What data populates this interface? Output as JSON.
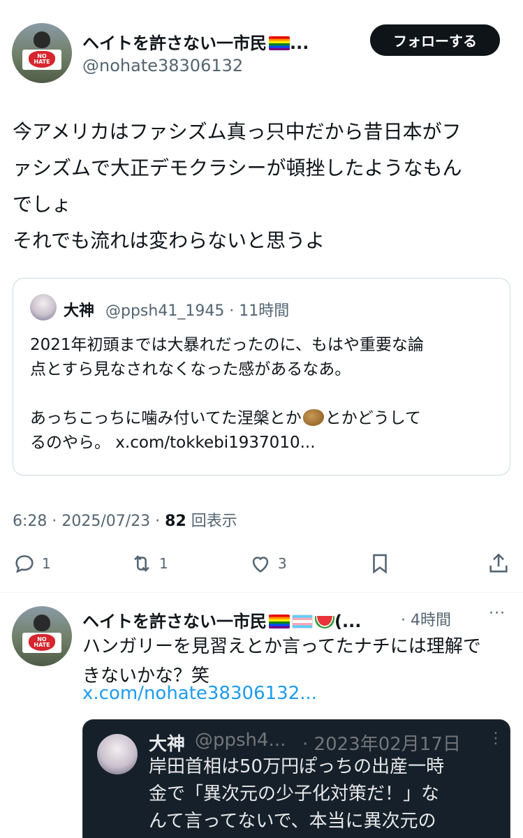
{
  "main_post": {
    "author_name": "ヘイトを許さない一市民",
    "author_name_suffix": "...",
    "handle": "@nohate38306132",
    "follow_label": "フォローする",
    "avatar_sign_text": "NO HATE",
    "body_lines": [
      "今アメリカはファシズム真っ只中だから昔日本がフ",
      "ァシズムで大正デモクラシーが頓挫したようなもん",
      "でしょ",
      "それでも流れは変わらないと思うよ"
    ],
    "quote": {
      "author_name": "大神",
      "handle_time": "@ppsh41_1945 · 11時間",
      "line1": "2021年初頭までは大暴れだったのに、もはや重要な論",
      "line2": "点とすら見なされなくなった感があるなあ。",
      "line3": "",
      "line4_before": "あっちこっちに噛み付いてた涅槃とか",
      "line4_after": "とかどうして",
      "line5": "るのやら。 x.com/tokkebi1937010..."
    },
    "meta": {
      "time_date": "6:28 · 2025/07/23 · ",
      "views_count": "82",
      "views_label": " 回表示"
    },
    "actions": {
      "replies": "1",
      "reposts": "1",
      "likes": "3"
    }
  },
  "reply_post": {
    "author_name": "ヘイトを許さない一市民",
    "author_name_suffix": "(...",
    "time": "· 4時間",
    "more": "···",
    "avatar_sign_text": "NO HATE",
    "body_lines": [
      "ハンガリーを見習えとか言ってたナチには理解で",
      "きないかな？笑"
    ],
    "link": "x.com/nohate38306132...",
    "quote": {
      "author_name": "大神",
      "handle": "@ppsh4...",
      "date": "· 2023年02月17日",
      "more": "⋮",
      "body_lines": [
        "岸田首相は50万円ぽっちの出産一時",
        "金で「異次元の少子化対策だ！」な",
        "んて言ってないで、本当に異次元の"
      ]
    }
  },
  "colors": {
    "text": "#0f1419",
    "secondary": "#536471",
    "link": "#1d9bf0",
    "button_bg": "#0f1419",
    "dark_card_bg": "#16202a"
  },
  "icons": [
    "reply-icon",
    "repost-icon",
    "like-icon",
    "bookmark-icon",
    "share-icon",
    "more-icon"
  ]
}
